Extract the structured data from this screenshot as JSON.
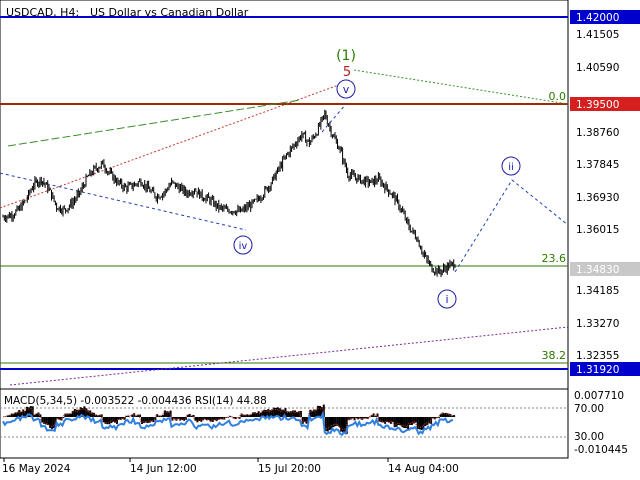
{
  "header": {
    "symbol": "USDCAD, H4:",
    "description": "US Dollar vs Canadian Dollar"
  },
  "colors": {
    "background": "#ffffff",
    "candles": "#000000",
    "level_blue": "#0000cc",
    "level_red": "#9b2b00",
    "level_green": "#2b7a00",
    "level_gray": "#888888",
    "wave_label": "#1a1aa8",
    "wave1_label": "#2b7a00",
    "wave5_label": "#b22222",
    "dotted_blue": "#1f3fb5",
    "dotted_red": "#c0392b",
    "dotted_green": "#3c8c2c",
    "dotted_purple": "#7a2a9a",
    "macd_hist": "#000000",
    "macd_signal": "#c0392b",
    "rsi_line": "#2f80e0",
    "badge_text": "#ffffff",
    "badge_current": "#c8c8c8"
  },
  "chart_data": {
    "type": "candlestick",
    "price_axis_ticks": [
      "1.41505",
      "1.40590",
      "1.39680",
      "1.38760",
      "1.37845",
      "1.36930",
      "1.36015",
      "1.35100",
      "1.34185",
      "1.33270",
      "1.32355"
    ],
    "time_axis_labels": [
      "16 May 2024",
      "14 Jun 12:00",
      "15 Jul 20:00",
      "14 Aug 04:00"
    ],
    "price_range": [
      1.313,
      1.4235
    ],
    "closes": [
      1.362,
      1.3625,
      1.364,
      1.367,
      1.3715,
      1.373,
      1.37,
      1.365,
      1.364,
      1.366,
      1.369,
      1.3735,
      1.376,
      1.3775,
      1.3745,
      1.372,
      1.3705,
      1.3712,
      1.3725,
      1.37,
      1.368,
      1.369,
      1.372,
      1.3705,
      1.369,
      1.37,
      1.368,
      1.367,
      1.365,
      1.364,
      1.364,
      1.3635,
      1.365,
      1.3665,
      1.369,
      1.372,
      1.376,
      1.38,
      1.383,
      1.386,
      1.3835,
      1.387,
      1.392,
      1.386,
      1.3815,
      1.3745,
      1.3735,
      1.3725,
      1.372,
      1.373,
      1.3705,
      1.368,
      1.364,
      1.359,
      1.356,
      1.3505,
      1.347,
      1.346,
      1.3475,
      1.3485
    ],
    "levels": [
      {
        "price": 1.42,
        "label": "1.42000",
        "kind": "blue"
      },
      {
        "price": 1.395,
        "label": "1.39500",
        "kind": "red"
      },
      {
        "price": 1.3483,
        "label": "1.34830",
        "kind": "current"
      },
      {
        "price": 1.3192,
        "label": "1.31920",
        "kind": "blue"
      }
    ],
    "fib_labels": [
      {
        "text": "0.0",
        "price": 1.395
      },
      {
        "text": "23.6",
        "price": 1.3492
      },
      {
        "text": "38.2",
        "price": 1.3216
      }
    ],
    "wave_labels": [
      {
        "text": "(1)",
        "kind": "wave1"
      },
      {
        "text": "5",
        "kind": "wave5"
      },
      {
        "text": "v",
        "kind": "circle"
      },
      {
        "text": "iv",
        "kind": "circle"
      },
      {
        "text": "ii",
        "kind": "circle"
      },
      {
        "text": "i",
        "kind": "circle"
      }
    ],
    "indicator": {
      "label": "MACD(5,34,5) -0.003522 -0.004436 RSI(14) 44.88",
      "ticks": [
        "0.007710",
        "70.00",
        "30.00",
        "-0.010445"
      ]
    }
  }
}
